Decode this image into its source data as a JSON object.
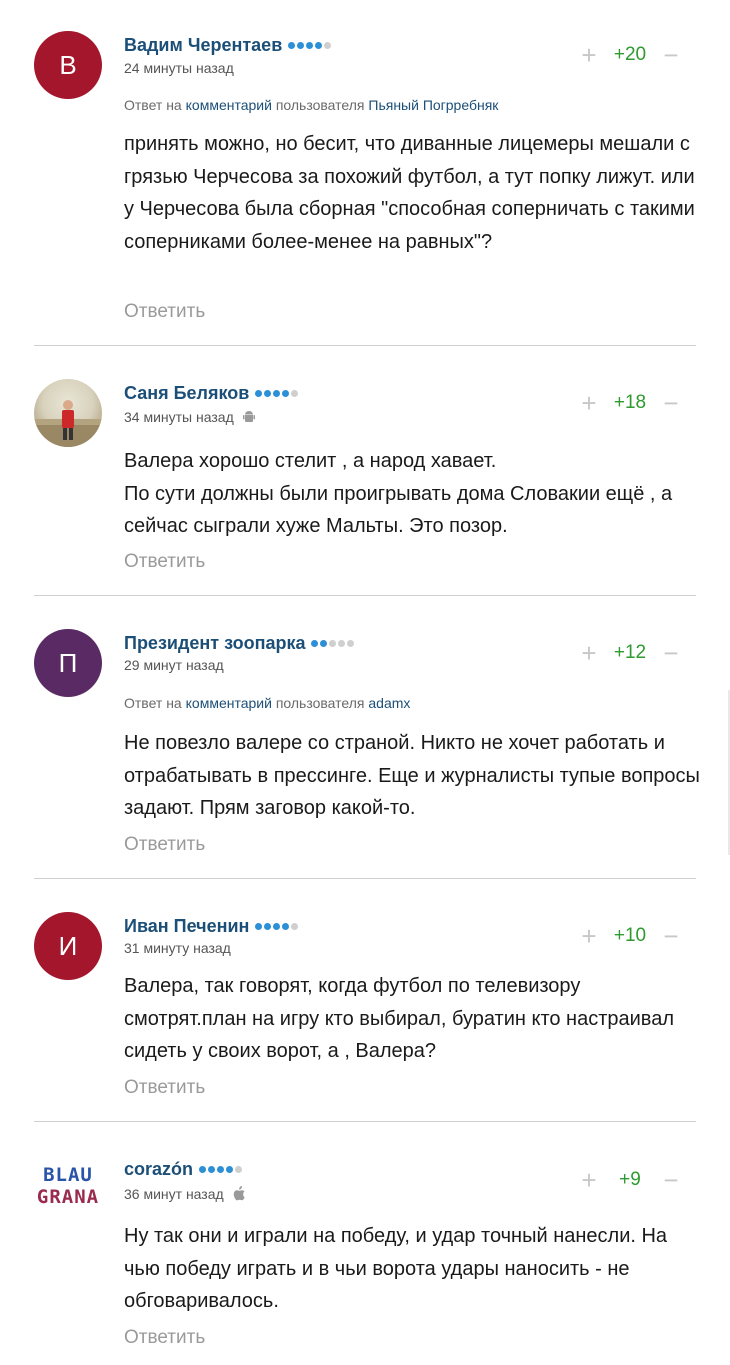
{
  "colors": {
    "author": "#1c4f78",
    "score": "#2f9a2f",
    "dot_on": "#2d8fd5",
    "dot_off": "#cfcfcf"
  },
  "ui": {
    "reply_prefix": "Ответ на",
    "reply_link": "комментарий",
    "reply_middle": "пользователя",
    "answer_label": "Ответить"
  },
  "comments": [
    {
      "author": "Вадим Черентаев",
      "avatar_letter": "В",
      "avatar_color": "#a3162b",
      "time": "24 минуты назад",
      "rating_dots": 4,
      "score": "+20",
      "reply_to": "Пьяный Погрребняк",
      "text": "принять можно, но бесит, что диванные лицемеры мешали с грязью Черчесова за похожий футбол, а тут попку лижут. или у Черчесова была сборная \"способная соперничать с такими соперниками более-менее на равных\"?"
    },
    {
      "author": "Саня Беляков",
      "avatar_type": "photo",
      "time": "34 минуты назад",
      "device": "android-icon",
      "rating_dots": 4,
      "score": "+18",
      "text": "Валера хорошо стелит , а народ хавает.\nПо сути должны были проигрывать дома Словакии ещё , а сейчас сыграли хуже Мальты. Это позор."
    },
    {
      "author": "Президент зоопарка",
      "avatar_letter": "П",
      "avatar_color": "#5a2a64",
      "time": "29 минут назад",
      "rating_dots": 2,
      "score": "+12",
      "reply_to": "adamx",
      "text": "Не повезло валере со страной. Никто не хочет работать и отрабатывать в прессинге. Еще и журналисты тупые вопросы задают. Прям заговор какой-то."
    },
    {
      "author": "Иван Печенин",
      "avatar_letter": "И",
      "avatar_color": "#a3162b",
      "time": "31 минуту назад",
      "rating_dots": 4,
      "score": "+10",
      "text": "Валера, так говорят, когда футбол по телевизору смотрят.план на игру кто выбирал, буратин кто настраивал сидеть у своих ворот, а , Валера?"
    },
    {
      "author": "corazón",
      "avatar_type": "logo",
      "logo_line1": "BLAU",
      "logo_line2": "GRANA",
      "time": "36 минут назад",
      "device": "apple-icon",
      "rating_dots": 4,
      "score": "+9",
      "text": "Ну так они и играли на победу, и удар точный нанесли. На чью победу играть и в чьи ворота удары наносить - не обговаривалось."
    }
  ]
}
